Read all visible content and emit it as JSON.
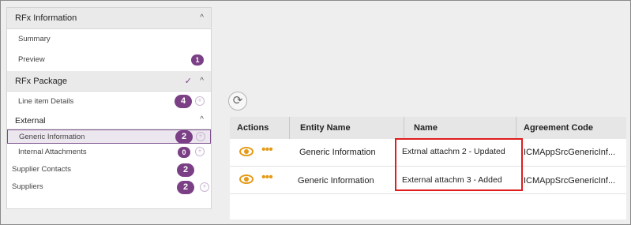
{
  "sidebar": {
    "sections": [
      {
        "title": "RFx Information"
      },
      {
        "title": "RFx Package"
      },
      {
        "title": "External"
      }
    ],
    "items": [
      {
        "label": "Summary"
      },
      {
        "label": "Preview",
        "count": "1"
      },
      {
        "label": "Line item Details",
        "count": "4"
      },
      {
        "label": "Generic Information",
        "count": "2"
      },
      {
        "label": "Internal Attachments",
        "count": "0"
      },
      {
        "label": "Supplier Contacts",
        "count": "2"
      },
      {
        "label": "Suppliers",
        "count": "2"
      }
    ]
  },
  "grid": {
    "columns": [
      "Actions",
      "Entity Name",
      "Name",
      "Agreement Code"
    ],
    "rows": [
      {
        "entity": "Generic Information",
        "name": "Extrnal attachm 2 - Updated",
        "code": "ICMAppSrcGenericInf..."
      },
      {
        "entity": "Generic Information",
        "name": "External attachm 3 - Added",
        "code": "ICMAppSrcGenericInf..."
      }
    ]
  },
  "icons": {
    "refresh": "refresh-icon",
    "view": "eye-icon",
    "more": "more-dots-icon",
    "chevron": "chevron-up-icon",
    "add": "add-circle-icon",
    "check": "checkmark-icon"
  },
  "colors": {
    "accent": "#7b3f86",
    "action_icon": "#e59a16",
    "highlight_border": "#e01e1e"
  }
}
